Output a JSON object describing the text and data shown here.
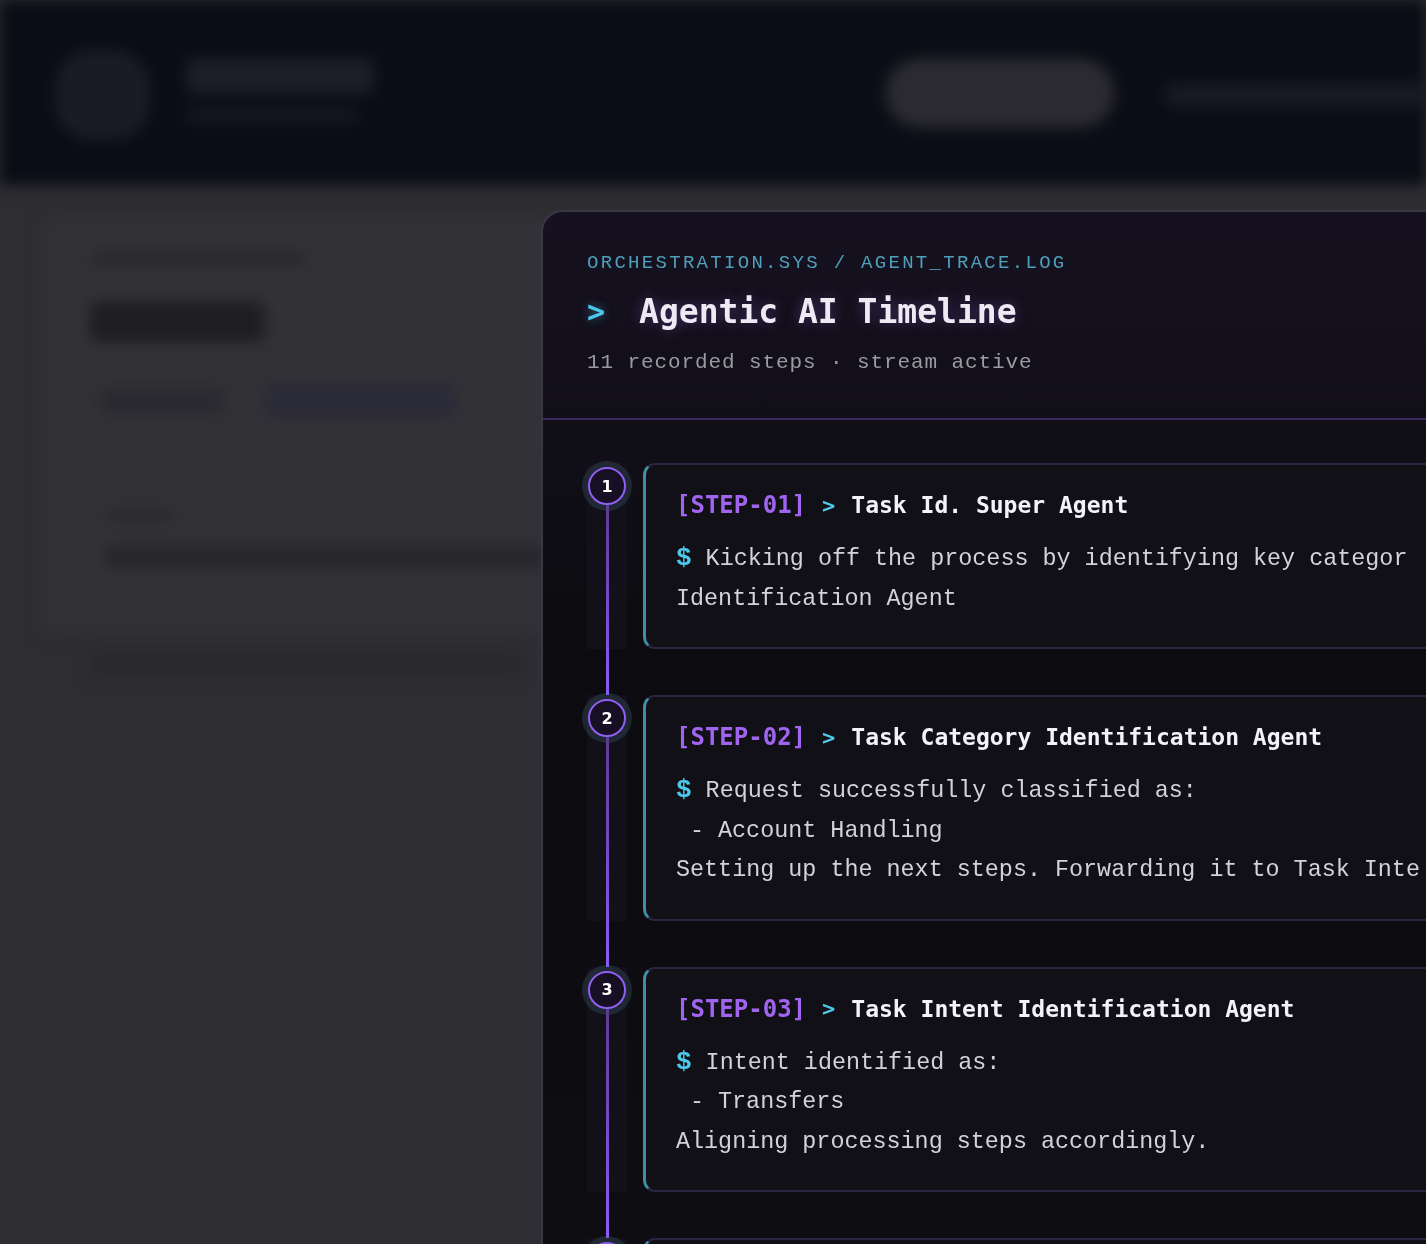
{
  "panel": {
    "breadcrumb": "ORCHESTRATION.SYS / AGENT_TRACE.LOG",
    "prompt": ">",
    "title": "Agentic AI Timeline",
    "subtitle": "11 recorded steps · stream active"
  },
  "steps": [
    {
      "kind": "entry",
      "number": "1",
      "tag": "[STEP-01]",
      "arrow": ">",
      "title": "Task Id. Super Agent",
      "lines": [
        {
          "kind": "prompt",
          "symbol": "$",
          "text": "Kicking off the process by identifying key categor"
        },
        {
          "kind": "text",
          "text": "Identification Agent"
        }
      ]
    },
    {
      "kind": "entry",
      "number": "2",
      "tag": "[STEP-02]",
      "arrow": ">",
      "title": "Task Category Identification Agent",
      "lines": [
        {
          "kind": "prompt",
          "symbol": "$",
          "text": "Request successfully classified as:"
        },
        {
          "kind": "bullet",
          "symbol": "-",
          "text": "Account Handling"
        },
        {
          "kind": "text",
          "text": "Setting up the next steps. Forwarding it to Task Inte"
        }
      ]
    },
    {
      "kind": "entry",
      "number": "3",
      "tag": "[STEP-03]",
      "arrow": ">",
      "title": "Task Intent Identification Agent",
      "lines": [
        {
          "kind": "prompt",
          "symbol": "$",
          "text": "Intent identified as:"
        },
        {
          "kind": "bullet",
          "symbol": "-",
          "text": "Transfers"
        },
        {
          "kind": "text",
          "text": "Aligning processing steps accordingly."
        }
      ]
    },
    {
      "kind": "partial"
    }
  ]
}
